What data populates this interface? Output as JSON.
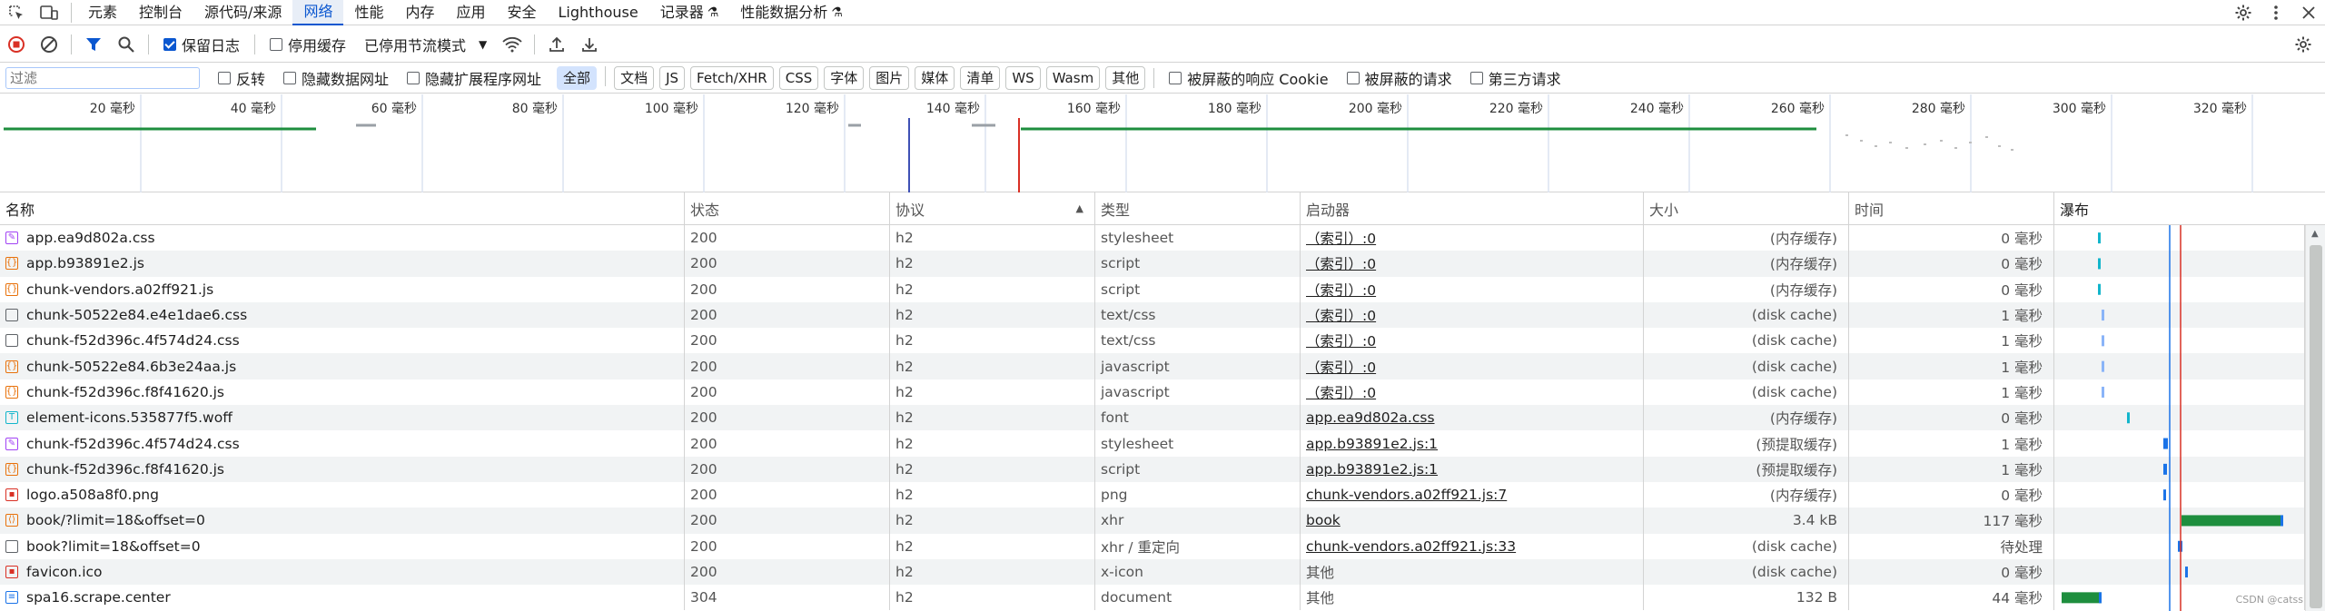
{
  "tabs": [
    "元素",
    "控制台",
    "源代码/来源",
    "网络",
    "性能",
    "内存",
    "应用",
    "安全",
    "Lighthouse",
    "记录器",
    "性能数据分析"
  ],
  "active_tab": "网络",
  "toolbar": {
    "preserve_log": "保留日志",
    "disable_cache": "停用缓存",
    "throttle": "已停用节流模式"
  },
  "filter": {
    "placeholder": "过滤",
    "invert": "反转",
    "hide_data_urls": "隐藏数据网址",
    "hide_ext_urls": "隐藏扩展程序网址",
    "types": [
      "全部",
      "文档",
      "JS",
      "Fetch/XHR",
      "CSS",
      "字体",
      "图片",
      "媒体",
      "清单",
      "WS",
      "Wasm",
      "其他"
    ],
    "blocked_cookies": "被屏蔽的响应 Cookie",
    "blocked_requests": "被屏蔽的请求",
    "third_party": "第三方请求"
  },
  "overview_ticks": [
    "20 毫秒",
    "40 毫秒",
    "60 毫秒",
    "80 毫秒",
    "100 毫秒",
    "120 毫秒",
    "140 毫秒",
    "160 毫秒",
    "180 毫秒",
    "200 毫秒",
    "220 毫秒",
    "240 毫秒",
    "260 毫秒",
    "280 毫秒",
    "300 毫秒",
    "320 毫秒"
  ],
  "columns": {
    "name": "名称",
    "status": "状态",
    "protocol": "协议",
    "type": "类型",
    "initiator": "启动器",
    "size": "大小",
    "time": "时间",
    "waterfall": "瀑布"
  },
  "rows": [
    {
      "name": "app.ea9d802a.css",
      "status": "200",
      "protocol": "h2",
      "type": "stylesheet",
      "initiator": "（索引）:0",
      "size": "(内存缓存)",
      "time": "0 毫秒",
      "icon": "css"
    },
    {
      "name": "app.b93891e2.js",
      "status": "200",
      "protocol": "h2",
      "type": "script",
      "initiator": "（索引）:0",
      "size": "(内存缓存)",
      "time": "0 毫秒",
      "icon": "js"
    },
    {
      "name": "chunk-vendors.a02ff921.js",
      "status": "200",
      "protocol": "h2",
      "type": "script",
      "initiator": "（索引）:0",
      "size": "(内存缓存)",
      "time": "0 毫秒",
      "icon": "js"
    },
    {
      "name": "chunk-50522e84.e4e1dae6.css",
      "status": "200",
      "protocol": "h2",
      "type": "text/css",
      "initiator": "（索引）:0",
      "size": "(disk cache)",
      "time": "1 毫秒",
      "icon": "doc"
    },
    {
      "name": "chunk-f52d396c.4f574d24.css",
      "status": "200",
      "protocol": "h2",
      "type": "text/css",
      "initiator": "（索引）:0",
      "size": "(disk cache)",
      "time": "1 毫秒",
      "icon": "doc"
    },
    {
      "name": "chunk-50522e84.6b3e24aa.js",
      "status": "200",
      "protocol": "h2",
      "type": "javascript",
      "initiator": "（索引）:0",
      "size": "(disk cache)",
      "time": "1 毫秒",
      "icon": "js"
    },
    {
      "name": "chunk-f52d396c.f8f41620.js",
      "status": "200",
      "protocol": "h2",
      "type": "javascript",
      "initiator": "（索引）:0",
      "size": "(disk cache)",
      "time": "1 毫秒",
      "icon": "js"
    },
    {
      "name": "element-icons.535877f5.woff",
      "status": "200",
      "protocol": "h2",
      "type": "font",
      "initiator": "app.ea9d802a.css",
      "size": "(内存缓存)",
      "time": "0 毫秒",
      "icon": "font"
    },
    {
      "name": "chunk-f52d396c.4f574d24.css",
      "status": "200",
      "protocol": "h2",
      "type": "stylesheet",
      "initiator": "app.b93891e2.js:1",
      "size": "(预提取缓存)",
      "time": "1 毫秒",
      "icon": "css"
    },
    {
      "name": "chunk-f52d396c.f8f41620.js",
      "status": "200",
      "protocol": "h2",
      "type": "script",
      "initiator": "app.b93891e2.js:1",
      "size": "(预提取缓存)",
      "time": "1 毫秒",
      "icon": "js"
    },
    {
      "name": "logo.a508a8f0.png",
      "status": "200",
      "protocol": "h2",
      "type": "png",
      "initiator": "chunk-vendors.a02ff921.js:7",
      "size": "(内存缓存)",
      "time": "0 毫秒",
      "icon": "img"
    },
    {
      "name": "book/?limit=18&offset=0",
      "status": "200",
      "protocol": "h2",
      "type": "xhr",
      "initiator": "book",
      "size": "3.4 kB",
      "time": "117 毫秒",
      "icon": "xhr"
    },
    {
      "name": "book?limit=18&offset=0",
      "status": "200",
      "protocol": "h2",
      "type": "xhr / 重定向",
      "initiator": "chunk-vendors.a02ff921.js:33",
      "size": "(disk cache)",
      "time": "待处理",
      "icon": "doc"
    },
    {
      "name": "favicon.ico",
      "status": "200",
      "protocol": "h2",
      "type": "x-icon",
      "initiator": "其他",
      "size": "(disk cache)",
      "time": "0 毫秒",
      "icon": "img"
    },
    {
      "name": "spa16.scrape.center",
      "status": "304",
      "protocol": "h2",
      "type": "document",
      "initiator": "其他",
      "size": "132 B",
      "time": "44 毫秒",
      "icon": "page"
    }
  ],
  "watermark": "CSDN @catss"
}
